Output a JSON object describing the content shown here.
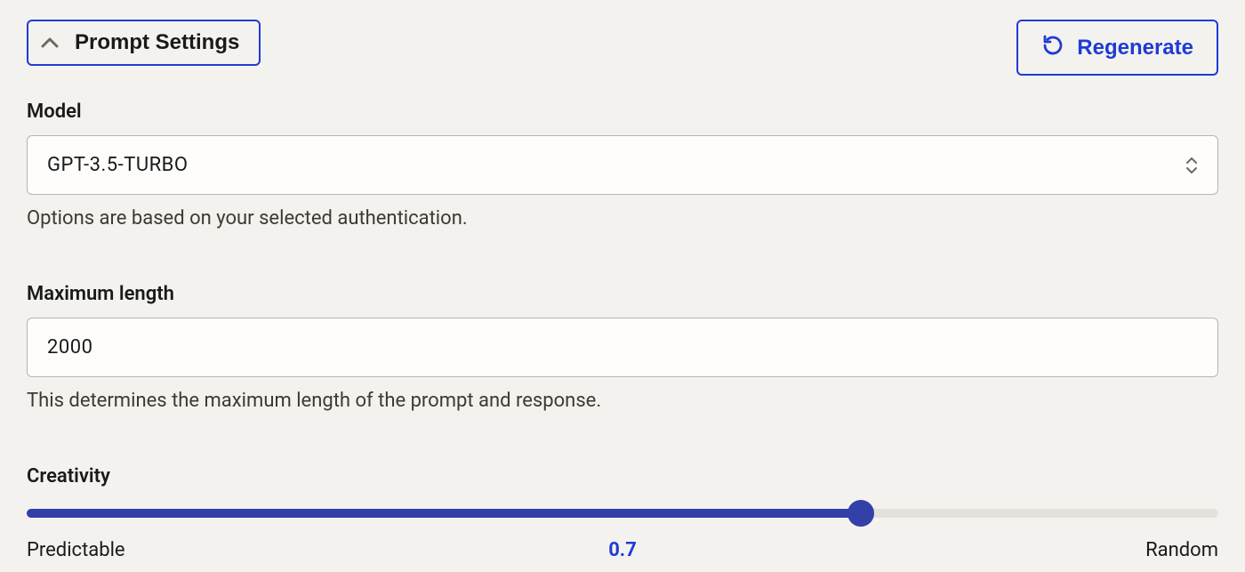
{
  "header": {
    "prompt_settings_label": "Prompt Settings",
    "regenerate_label": "Regenerate"
  },
  "model": {
    "label": "Model",
    "value": "GPT-3.5-TURBO",
    "help": "Options are based on your selected authentication."
  },
  "max_length": {
    "label": "Maximum length",
    "value": "2000",
    "help": "This determines the maximum length of the prompt and response."
  },
  "creativity": {
    "label": "Creativity",
    "min_label": "Predictable",
    "max_label": "Random",
    "value_label": "0.7",
    "value_fraction": 0.7
  },
  "colors": {
    "accent": "#1f3bd6",
    "slider": "#3340a8",
    "bg": "#f4f2ef"
  }
}
